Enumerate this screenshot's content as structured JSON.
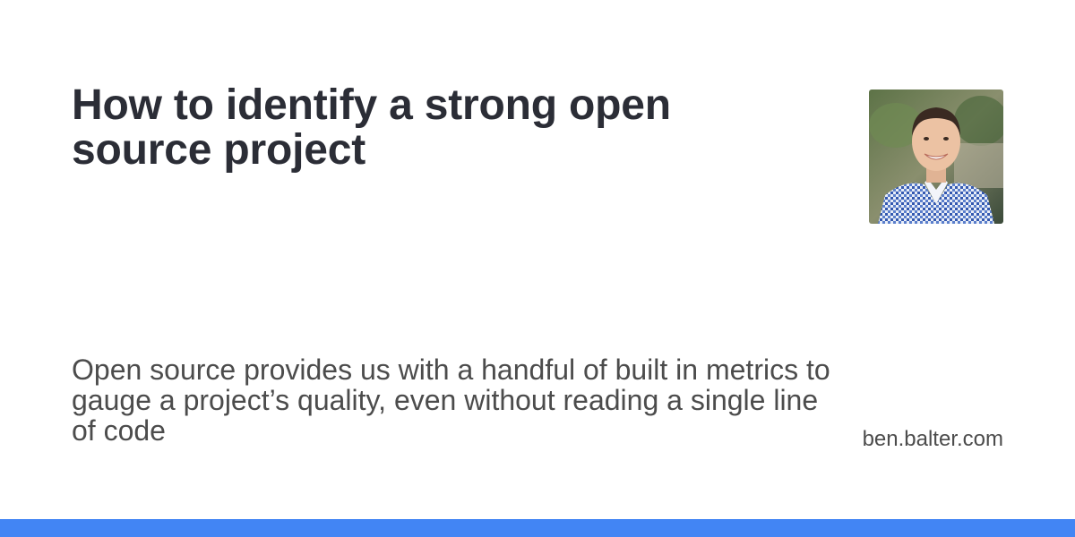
{
  "card": {
    "title": "How to identify a strong open source project",
    "description": "Open source provides us with a handful of built in metrics to gauge a project’s quality, even without reading a single line of code",
    "site": "ben.balter.com",
    "accent_color": "#4285f4",
    "avatar_icon": "author-avatar-icon"
  }
}
